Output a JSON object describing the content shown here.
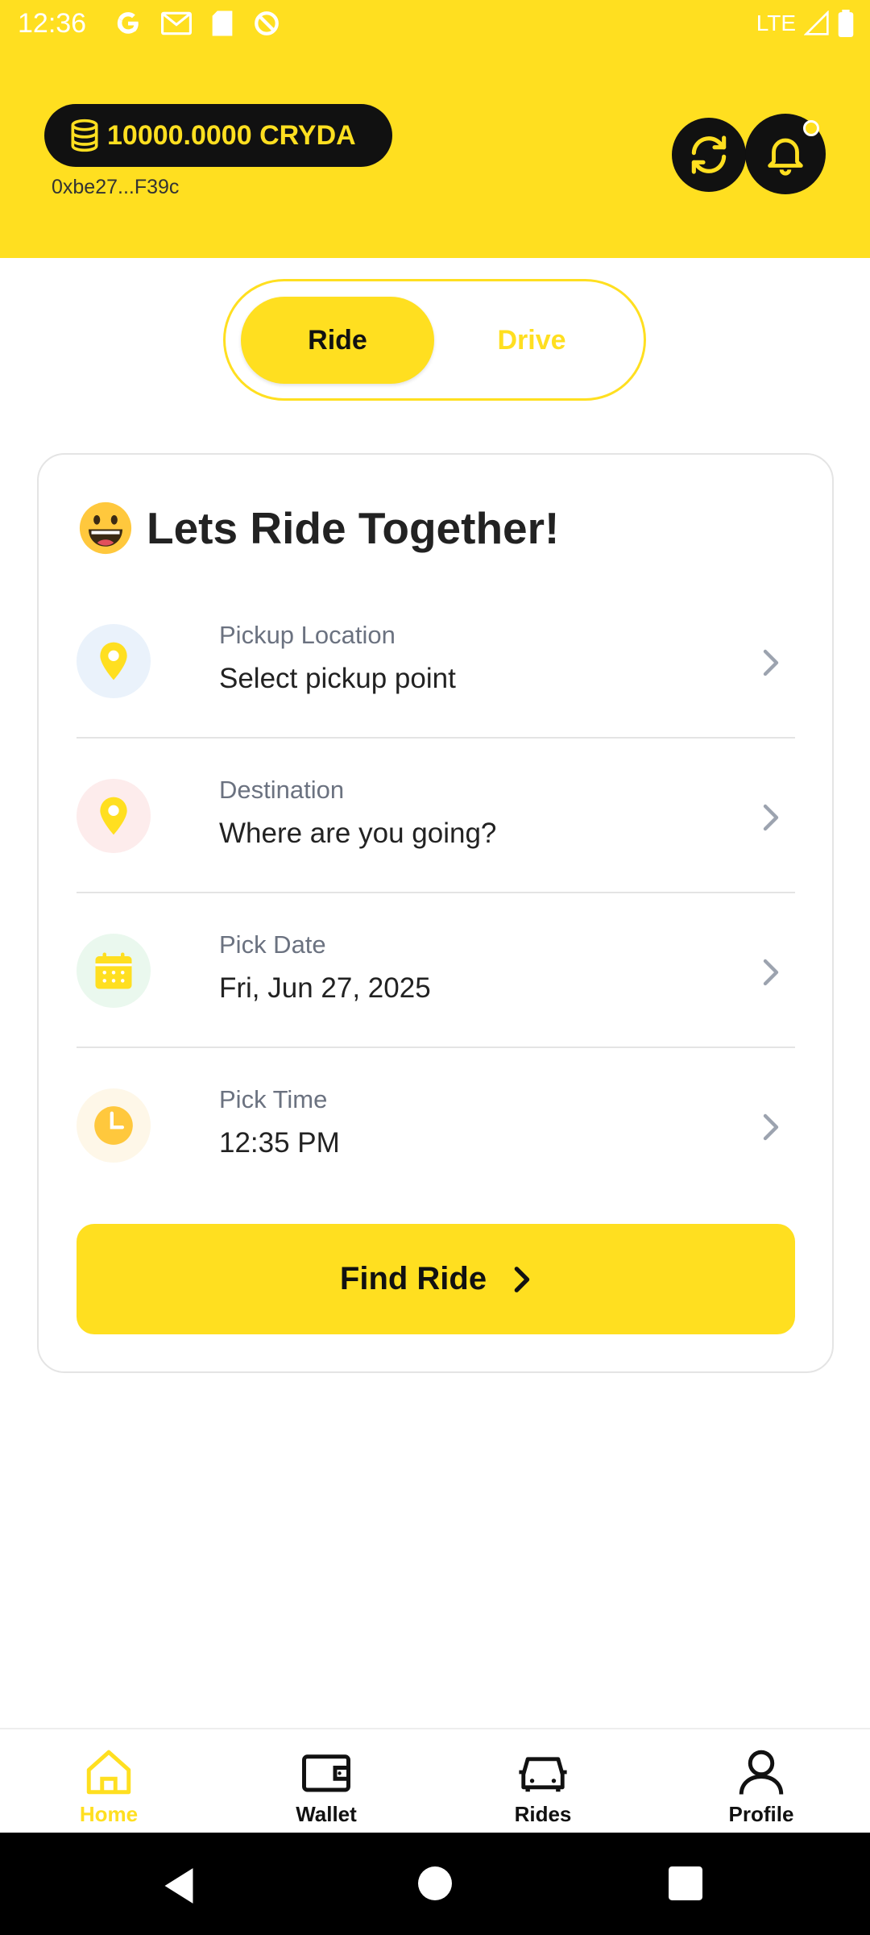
{
  "status_bar": {
    "time": "12:36",
    "network": "LTE"
  },
  "header": {
    "balance": "10000.0000 CRYDA",
    "wallet_address": "0xbe27...F39c"
  },
  "toggle": {
    "ride_label": "Ride",
    "drive_label": "Drive",
    "selected": "Ride"
  },
  "card": {
    "emoji": "😀",
    "title": "Lets Ride Together!",
    "rows": [
      {
        "label": "Pickup Location",
        "value": "Select pickup point",
        "icon": "location-pin-icon"
      },
      {
        "label": "Destination",
        "value": "Where are you going?",
        "icon": "location-pin-icon"
      },
      {
        "label": "Pick Date",
        "value": "Fri, Jun 27, 2025",
        "icon": "calendar-icon"
      },
      {
        "label": "Pick Time",
        "value": "12:35 PM",
        "icon": "clock-icon"
      }
    ],
    "find_button": "Find Ride"
  },
  "bottom_nav": {
    "items": [
      {
        "label": "Home",
        "icon": "home-icon",
        "active": true
      },
      {
        "label": "Wallet",
        "icon": "wallet-icon",
        "active": false
      },
      {
        "label": "Rides",
        "icon": "car-icon",
        "active": false
      },
      {
        "label": "Profile",
        "icon": "person-icon",
        "active": false
      }
    ]
  },
  "colors": {
    "accent": "#FFDF20",
    "dark": "#111111",
    "muted": "#6b7280"
  }
}
